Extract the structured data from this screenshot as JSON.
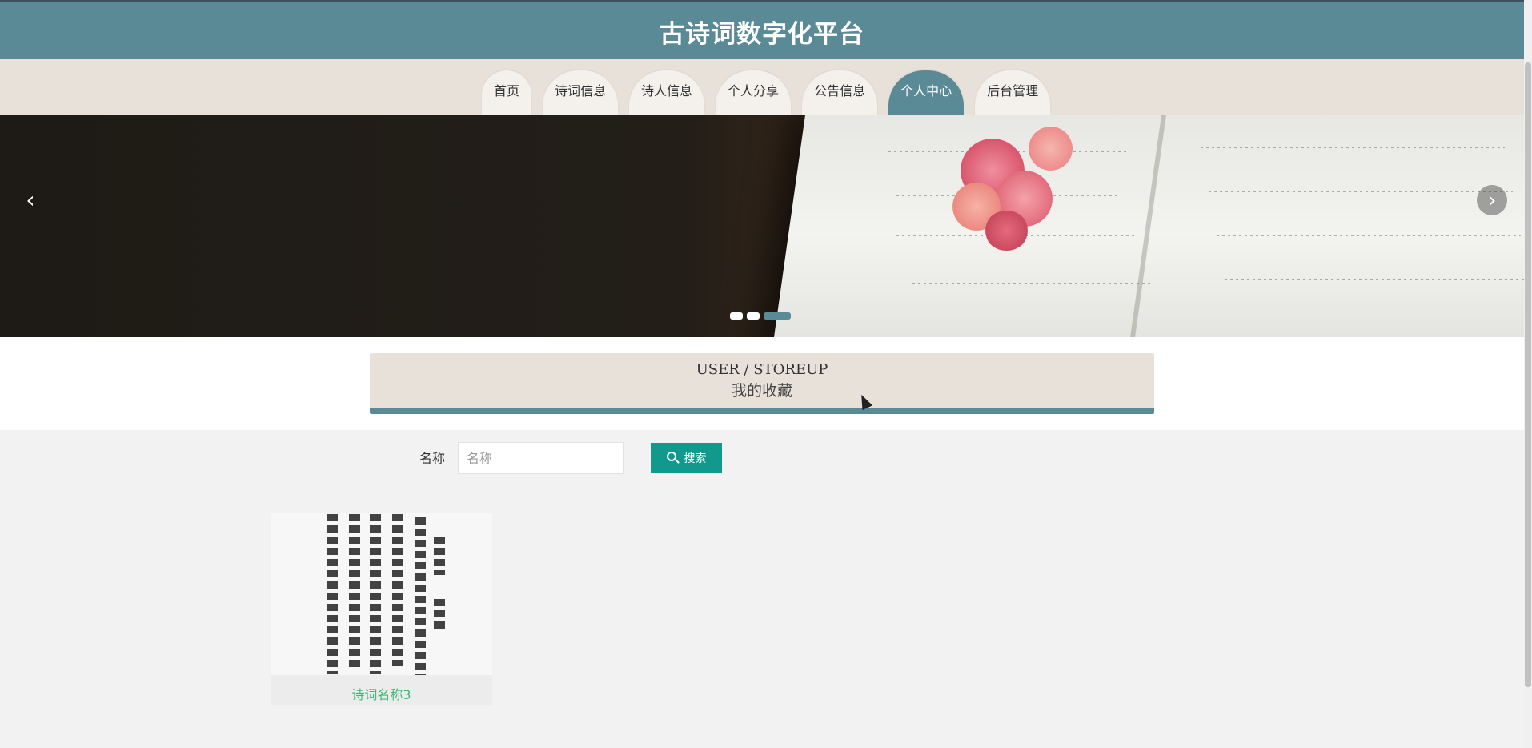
{
  "header": {
    "title": "古诗词数字化平台"
  },
  "nav": {
    "items": [
      {
        "label": "首页",
        "active": false
      },
      {
        "label": "诗词信息",
        "active": false
      },
      {
        "label": "诗人信息",
        "active": false
      },
      {
        "label": "个人分享",
        "active": false
      },
      {
        "label": "公告信息",
        "active": false
      },
      {
        "label": "个人中心",
        "active": true
      },
      {
        "label": "后台管理",
        "active": false
      }
    ]
  },
  "banner": {
    "prev_icon": "chevron-left-icon",
    "next_icon": "chevron-right-icon",
    "slide_count": 3,
    "active_slide": 3
  },
  "section": {
    "title_en": "USER / STOREUP",
    "title_cn": "我的收藏"
  },
  "search": {
    "label": "名称",
    "placeholder": "名称",
    "value": "",
    "button_label": "搜索",
    "button_icon": "search-icon"
  },
  "items": [
    {
      "name": "诗词名称3"
    }
  ],
  "colors": {
    "primary": "#5a8a96",
    "nav_bg": "#e8e1d9",
    "search_button": "#11998e",
    "item_name": "#3cb878"
  }
}
